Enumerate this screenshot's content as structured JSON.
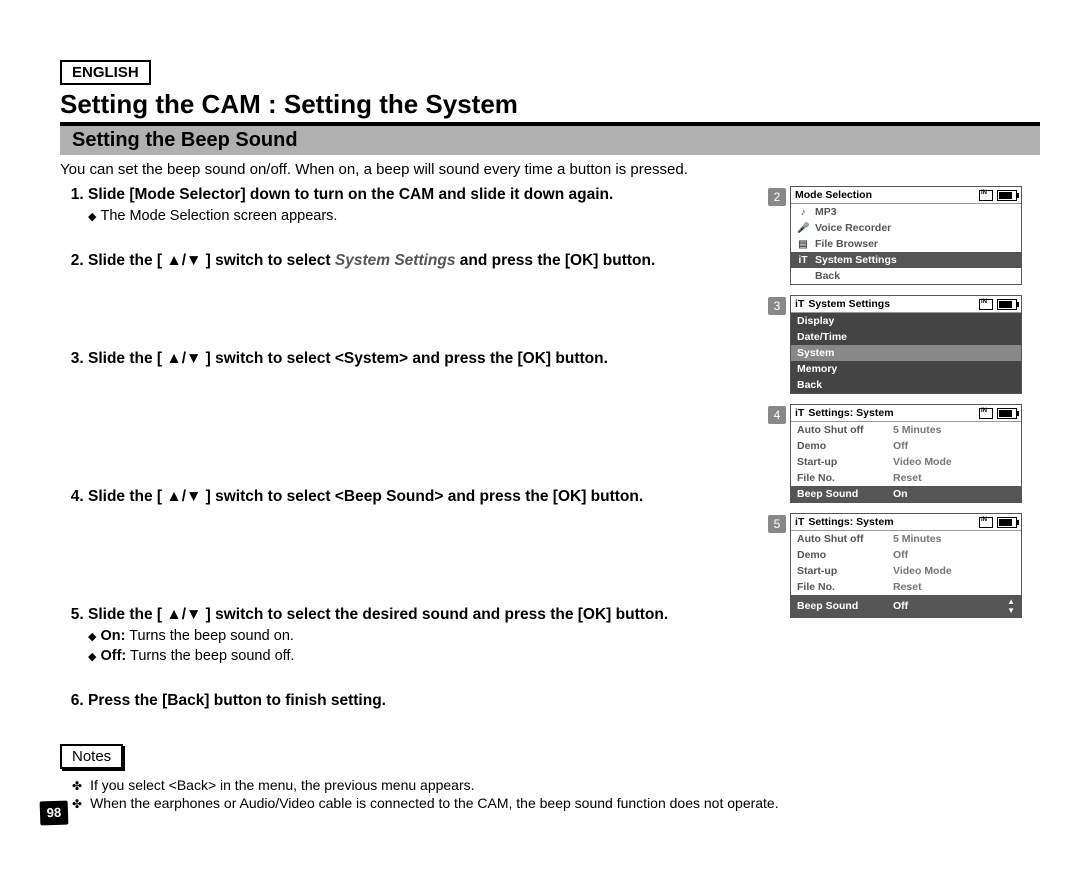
{
  "language_tag": "ENGLISH",
  "main_title": "Setting the CAM : Setting the System",
  "sub_title": "Setting the Beep Sound",
  "intro": "You can set the beep sound on/off. When on, a beep will sound every time a button is pressed.",
  "steps": [
    {
      "text_pre": "Slide [Mode Selector] down to turn on the CAM and slide it down again.",
      "bullets": [
        {
          "label": "",
          "text": "The Mode Selection screen appears."
        }
      ]
    },
    {
      "text_pre": "Slide the [ ▲/▼ ] switch to select ",
      "italic": "System Settings",
      "text_post": " and press the [OK] button."
    },
    {
      "text_pre": "Slide the [ ▲/▼ ] switch to select <System> and press the [OK] button."
    },
    {
      "text_pre": "Slide the [ ▲/▼ ] switch to select <Beep Sound> and press the [OK] button."
    },
    {
      "text_pre": "Slide the [ ▲/▼ ] switch to select the desired sound and press the [OK] button.",
      "bullets": [
        {
          "label": "On:",
          "text": "Turns the beep sound on."
        },
        {
          "label": "Off:",
          "text": "Turns the beep sound off."
        }
      ]
    },
    {
      "text_pre": "Press the [Back] button to finish setting."
    }
  ],
  "notes_label": "Notes",
  "notes": [
    "If you select <Back> in the menu, the previous menu appears.",
    "When the earphones or Audio/Video cable is connected to the CAM, the beep sound function does not operate."
  ],
  "page_number": "98",
  "screens": [
    {
      "num": "2",
      "title": "Mode Selection",
      "rows": [
        {
          "icon": "♪",
          "label": "MP3",
          "sel": false
        },
        {
          "icon": "🎤",
          "label": "Voice Recorder",
          "sel": false
        },
        {
          "icon": "▤",
          "label": "File Browser",
          "sel": false
        },
        {
          "icon": "iT",
          "label": "System Settings",
          "sel": true
        },
        {
          "icon": "",
          "label": "Back",
          "sel": false
        }
      ]
    },
    {
      "num": "3",
      "title": "System Settings",
      "title_icon": "iT",
      "rows": [
        {
          "label": "Display",
          "sel": false,
          "dark": true
        },
        {
          "label": "Date/Time",
          "sel": false,
          "dark": true
        },
        {
          "label": "System",
          "sel": true
        },
        {
          "label": "Memory",
          "sel": false,
          "dark": true
        },
        {
          "label": "Back",
          "sel": false,
          "dark": true
        }
      ]
    },
    {
      "num": "4",
      "title": "Settings: System",
      "title_icon": "iT",
      "kv": [
        {
          "k": "Auto Shut off",
          "v": "5 Minutes",
          "sel": false
        },
        {
          "k": "Demo",
          "v": "Off",
          "sel": false
        },
        {
          "k": "Start-up",
          "v": "Video Mode",
          "sel": false
        },
        {
          "k": "File No.",
          "v": "Reset",
          "sel": false
        },
        {
          "k": "Beep Sound",
          "v": "On",
          "sel": true
        }
      ]
    },
    {
      "num": "5",
      "title": "Settings: System",
      "title_icon": "iT",
      "kv": [
        {
          "k": "Auto Shut off",
          "v": "5 Minutes",
          "sel": false
        },
        {
          "k": "Demo",
          "v": "Off",
          "sel": false
        },
        {
          "k": "Start-up",
          "v": "Video Mode",
          "sel": false
        },
        {
          "k": "File No.",
          "v": "Reset",
          "sel": false
        },
        {
          "k": "Beep Sound",
          "v": "Off",
          "sel": true,
          "arrows": true
        }
      ]
    }
  ]
}
